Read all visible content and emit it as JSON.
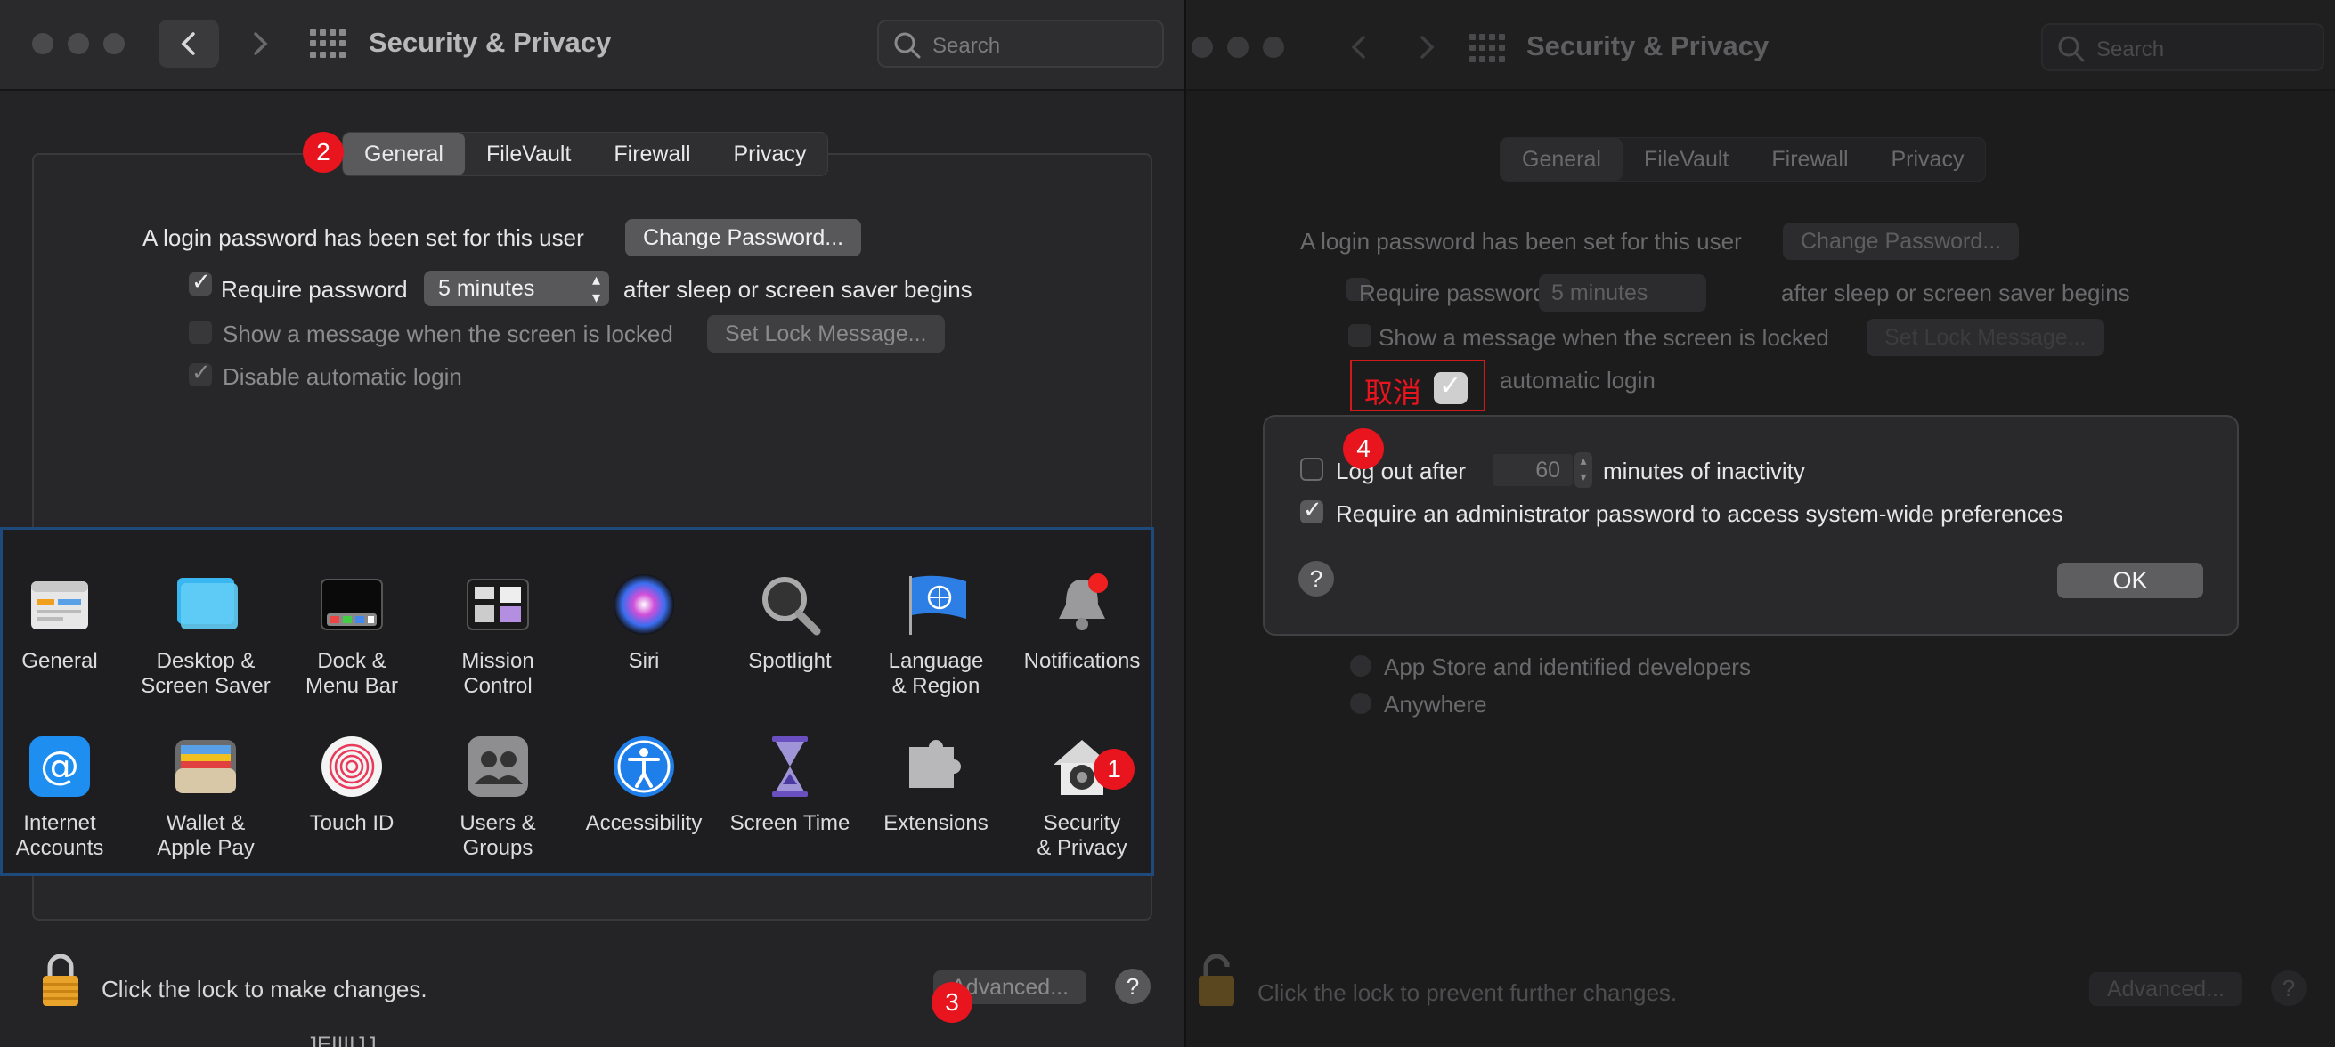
{
  "left_window": {
    "title": "Security & Privacy",
    "search_placeholder": "Search",
    "tabs": [
      "General",
      "FileVault",
      "Firewall",
      "Privacy"
    ],
    "login_text": "A login password has been set for this user",
    "change_password": "Change Password...",
    "require_password": "Require password",
    "require_interval": "5 minutes",
    "after_sleep": "after sleep or screen saver begins",
    "show_message": "Show a message when the screen is locked",
    "set_lock_message": "Set Lock Message...",
    "disable_auto_login": "Disable automatic login",
    "lock_text": "Click the lock to make changes.",
    "advanced": "Advanced...",
    "help": "?",
    "partial_text": "JEIIIIJJ"
  },
  "prefs": {
    "row1": [
      {
        "label1": "General",
        "label2": "",
        "icon": "general-icon"
      },
      {
        "label1": "Desktop &",
        "label2": "Screen Saver",
        "icon": "desktop-icon"
      },
      {
        "label1": "Dock &",
        "label2": "Menu Bar",
        "icon": "dock-icon"
      },
      {
        "label1": "Mission",
        "label2": "Control",
        "icon": "mission-control-icon"
      },
      {
        "label1": "Siri",
        "label2": "",
        "icon": "siri-icon"
      },
      {
        "label1": "Spotlight",
        "label2": "",
        "icon": "spotlight-icon"
      },
      {
        "label1": "Language",
        "label2": "& Region",
        "icon": "language-icon"
      },
      {
        "label1": "Notifications",
        "label2": "",
        "icon": "notifications-icon"
      }
    ],
    "row2": [
      {
        "label1": "Internet",
        "label2": "Accounts",
        "icon": "internet-accounts-icon"
      },
      {
        "label1": "Wallet &",
        "label2": "Apple Pay",
        "icon": "wallet-icon"
      },
      {
        "label1": "Touch ID",
        "label2": "",
        "icon": "touch-id-icon"
      },
      {
        "label1": "Users &",
        "label2": "Groups",
        "icon": "users-icon"
      },
      {
        "label1": "Accessibility",
        "label2": "",
        "icon": "accessibility-icon"
      },
      {
        "label1": "Screen Time",
        "label2": "",
        "icon": "screen-time-icon"
      },
      {
        "label1": "Extensions",
        "label2": "",
        "icon": "extensions-icon"
      },
      {
        "label1": "Security",
        "label2": "& Privacy",
        "icon": "security-icon"
      }
    ]
  },
  "right_window": {
    "title": "Security & Privacy",
    "search_placeholder": "Search",
    "tabs": [
      "General",
      "FileVault",
      "Firewall",
      "Privacy"
    ],
    "login_text": "A login password has been set for this user",
    "change_password": "Change Password...",
    "require_password": "Require password",
    "require_interval": "5 minutes",
    "after_sleep": "after sleep or screen saver begins",
    "show_message": "Show a message when the screen is locked",
    "set_lock_message": "Set Lock Message...",
    "auto_login_partial": "automatic login",
    "app_store": "App Store and identified developers",
    "anywhere": "Anywhere",
    "lock_text": "Click the lock to prevent further changes.",
    "advanced": "Advanced...",
    "help": "?"
  },
  "sheet": {
    "log_out_after": "Log out after",
    "minutes_value": "60",
    "minutes_text": "minutes of inactivity",
    "require_admin": "Require an administrator password to access system-wide preferences",
    "help": "?",
    "ok": "OK"
  },
  "annotations": {
    "badge1": "1",
    "badge2": "2",
    "badge3": "3",
    "badge4": "4",
    "cancel_label": "取消"
  },
  "colors": {
    "badge": "#e8141e",
    "highlight_border": "#1d4a7a",
    "annotation_box": "#d01a1a"
  }
}
